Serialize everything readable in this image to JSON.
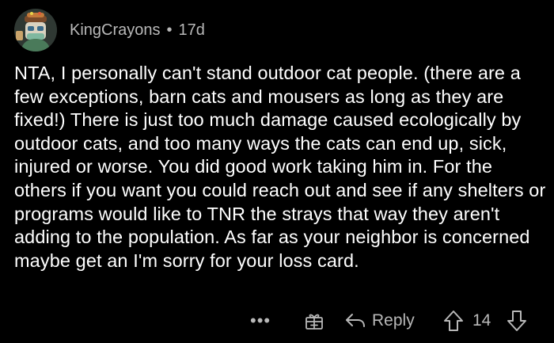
{
  "comment": {
    "username": "KingCrayons",
    "separator": "•",
    "age": "17d",
    "body": "NTA, I personally can't stand outdoor cat people. (there are a few exceptions, barn cats and mousers as long as they are fixed!) There is just too much damage caused ecologically by outdoor cats, and too many ways the cats can end up, sick, injured or worse. You did good work taking him in. For the others if you want you could reach out and see if any shelters or programs would like to TNR the strays that way they aren't adding to the population. As far as your neighbor is concerned maybe get an I'm sorry for your loss card."
  },
  "actions": {
    "more_label": "•••",
    "reply_label": "Reply",
    "vote_count": "14",
    "icons": [
      "more-icon",
      "award-icon",
      "reply-arrow-icon",
      "upvote-icon",
      "downvote-icon"
    ]
  },
  "colors": {
    "background": "#000000",
    "text": "#ffffff",
    "muted": "#b8b8b8"
  }
}
